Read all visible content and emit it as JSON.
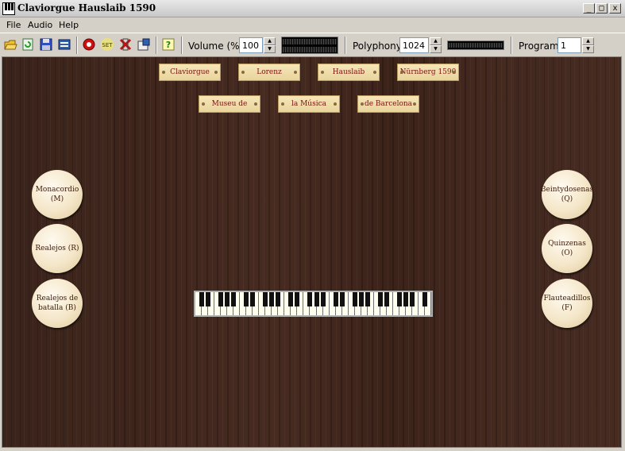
{
  "window": {
    "title": "Claviorgue Hauslaib 1590",
    "minimize_glyph": "_",
    "maximize_glyph": "□",
    "close_glyph": "x"
  },
  "menu": {
    "items": [
      "File",
      "Audio",
      "Help"
    ]
  },
  "toolbar": {
    "icons": [
      "open-icon",
      "reload-icon",
      "save-icon",
      "properties-icon",
      "record-icon",
      "set-icon",
      "panic-icon",
      "settings-icon",
      "help-icon"
    ],
    "set_label": "SET",
    "help_glyph": "?",
    "volume_label": "Volume (%):",
    "volume_value": "100",
    "polyphony_label": "Polyphony:",
    "polyphony_value": "1024",
    "program_label": "Program:",
    "program_value": "1",
    "spin_up": "▲",
    "spin_down": "▼"
  },
  "labels_row1": [
    "Claviorgue",
    "Lorenz",
    "Hauslaib",
    "Nürnberg 1590"
  ],
  "labels_row2": [
    "Museu de",
    "la Música",
    "de Barcelona"
  ],
  "stops_left": [
    "Monacordio\n(M)",
    "Realejos (R)",
    "Realejos de\nbatalla (B)"
  ],
  "stops_right": [
    "Beintydosenas\n(Q)",
    "Quinzenas\n(O)",
    "Flauteadillos\n(F)"
  ],
  "colors": {
    "label_text": "#7a1010",
    "label_bg": "#f0deab",
    "wood": "#442a20",
    "stop_bg": "#f4e6c8"
  }
}
